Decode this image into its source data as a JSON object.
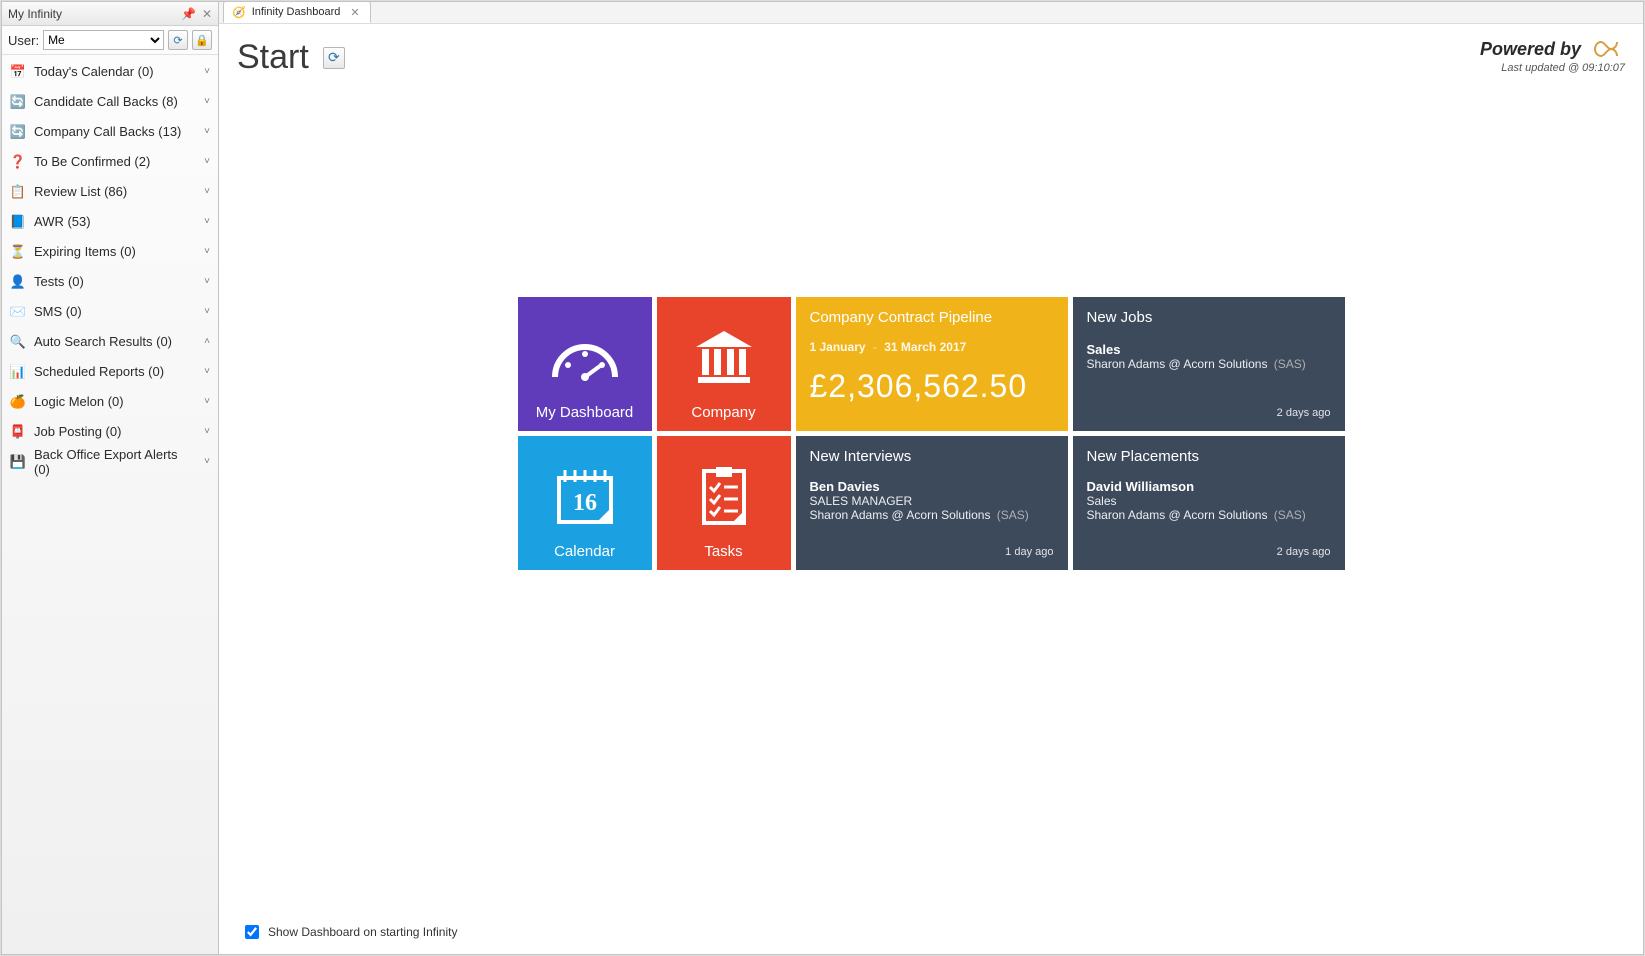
{
  "sidebar": {
    "title": "My Infinity",
    "user_label": "User:",
    "user_value": "Me",
    "items": [
      {
        "icon": "📅",
        "label": "Today's Calendar (0)",
        "chev": "˅"
      },
      {
        "icon": "🔄",
        "label": "Candidate Call Backs (8)",
        "chev": "˅",
        "iconColor": "#2e9e2e"
      },
      {
        "icon": "🔄",
        "label": "Company Call Backs (13)",
        "chev": "˅",
        "iconColor": "#2e9e2e"
      },
      {
        "icon": "❓",
        "label": "To Be Confirmed (2)",
        "chev": "˅",
        "iconColor": "#2a7ab0"
      },
      {
        "icon": "📋",
        "label": "Review List (86)",
        "chev": "˅",
        "iconColor": "#6a8a3a"
      },
      {
        "icon": "📘",
        "label": "AWR (53)",
        "chev": "˅",
        "iconColor": "#2a5aa0"
      },
      {
        "icon": "⏳",
        "label": "Expiring Items (0)",
        "chev": "˅"
      },
      {
        "icon": "👤",
        "label": "Tests (0)",
        "chev": "˅"
      },
      {
        "icon": "✉️",
        "label": "SMS (0)",
        "chev": "˅",
        "iconColor": "#2a7ab0"
      },
      {
        "icon": "🔍",
        "label": "Auto Search Results (0)",
        "chev": "˄"
      },
      {
        "icon": "📊",
        "label": "Scheduled Reports (0)",
        "chev": "˅"
      },
      {
        "icon": "🍊",
        "label": "Logic Melon (0)",
        "chev": "˅",
        "iconColor": "#e05a00"
      },
      {
        "icon": "📮",
        "label": "Job Posting (0)",
        "chev": "˅",
        "iconColor": "#c02020"
      },
      {
        "icon": "💾",
        "label": "Back Office Export Alerts (0)",
        "chev": "˅"
      }
    ]
  },
  "tab": {
    "title": "Infinity Dashboard"
  },
  "header": {
    "title": "Start",
    "powered_by": "Powered by",
    "timestamp": "Last updated @ 09:10:07"
  },
  "tiles": {
    "my_dashboard": "My Dashboard",
    "company": "Company",
    "calendar": "Calendar",
    "calendar_day": "16",
    "tasks": "Tasks",
    "pipeline": {
      "title": "Company Contract Pipeline",
      "from": "1 January",
      "dash": "-",
      "to": "31 March 2017",
      "amount": "£2,306,562.50"
    },
    "new_jobs": {
      "title": "New Jobs",
      "line1": "Sales",
      "line2": "Sharon Adams @ Acorn Solutions",
      "tag": "(SAS)",
      "time": "2 days ago"
    },
    "new_interviews": {
      "title": "New Interviews",
      "line1": "Ben Davies",
      "line2": "SALES MANAGER",
      "line3": "Sharon Adams @ Acorn Solutions",
      "tag": "(SAS)",
      "time": "1 day ago"
    },
    "new_placements": {
      "title": "New Placements",
      "line1": "David Williamson",
      "line2": "Sales",
      "line3": "Sharon Adams @ Acorn Solutions",
      "tag": "(SAS)",
      "time": "2 days ago"
    }
  },
  "footer": {
    "checkbox_label": "Show Dashboard on starting Infinity"
  }
}
